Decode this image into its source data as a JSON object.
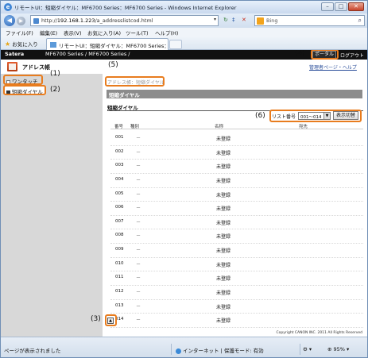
{
  "window": {
    "title": "リモートUI：短縮ダイヤル：MF6700 Series：MF6700 Series - Windows Internet Explorer"
  },
  "address": {
    "url_pre": "http://",
    "url_host": "192.168.1.223",
    "url_rest": "/a_addresslistcod.html"
  },
  "search": {
    "placeholder": "Bing"
  },
  "menu": [
    "ファイル(F)",
    "編集(E)",
    "表示(V)",
    "お気に入り(A)",
    "ツール(T)",
    "ヘルプ(H)"
  ],
  "favorites": {
    "label": "お気に入り"
  },
  "tab": {
    "label": "リモートUI：短縮ダイヤル：MF6700 Series：..."
  },
  "header": {
    "brand": "Satera",
    "model": "MF6700 Series / MF6700 Series /",
    "portal": "ポータルへ",
    "logout": "ログアウト"
  },
  "sidebar": {
    "title": "アドレス帳",
    "items": [
      "ワンタッチ",
      "短縮ダイヤル"
    ]
  },
  "links": {
    "manager": "管理者ページ・ヘルプ"
  },
  "main": {
    "breadcrumb": "アドレス帳：短縮ダイヤル",
    "section": "短縮ダイヤル",
    "subtitle": "短縮ダイヤル",
    "list_label": "リスト番号",
    "list_value": "001～014",
    "switch_label": "表示切替",
    "columns": {
      "num": "番号",
      "type": "種別",
      "name": "名称",
      "dest": "宛先"
    },
    "rows": [
      {
        "num": "001",
        "type": "－",
        "name": "未登録"
      },
      {
        "num": "002",
        "type": "－",
        "name": "未登録"
      },
      {
        "num": "003",
        "type": "－",
        "name": "未登録"
      },
      {
        "num": "004",
        "type": "－",
        "name": "未登録"
      },
      {
        "num": "005",
        "type": "－",
        "name": "未登録"
      },
      {
        "num": "006",
        "type": "－",
        "name": "未登録"
      },
      {
        "num": "007",
        "type": "－",
        "name": "未登録"
      },
      {
        "num": "008",
        "type": "－",
        "name": "未登録"
      },
      {
        "num": "009",
        "type": "－",
        "name": "未登録"
      },
      {
        "num": "010",
        "type": "－",
        "name": "未登録"
      },
      {
        "num": "011",
        "type": "－",
        "name": "未登録"
      },
      {
        "num": "012",
        "type": "－",
        "name": "未登録"
      },
      {
        "num": "013",
        "type": "－",
        "name": "未登録"
      },
      {
        "num": "014",
        "type": "－",
        "name": "未登録"
      }
    ],
    "copyright": "Copyright CANON INC. 2011 All Rights Reserved"
  },
  "callouts": [
    "(1)",
    "(2)",
    "(3)",
    "(4)",
    "(5)",
    "(6)"
  ],
  "status": {
    "text": "ページが表示されました",
    "zone": "インターネット | 保護モード: 有効",
    "zoom": "95%"
  },
  "colors": {
    "highlight": "#e87c1e",
    "header_bg": "#111111",
    "section_bg": "#8c8c8c"
  },
  "icons": [
    "ie-icon",
    "back-arrow-icon",
    "forward-arrow-icon",
    "refresh-icon",
    "stop-icon",
    "bing-icon",
    "search-icon",
    "favorites-star-icon",
    "address-book-icon",
    "globe-icon",
    "top-arrow-icon"
  ]
}
